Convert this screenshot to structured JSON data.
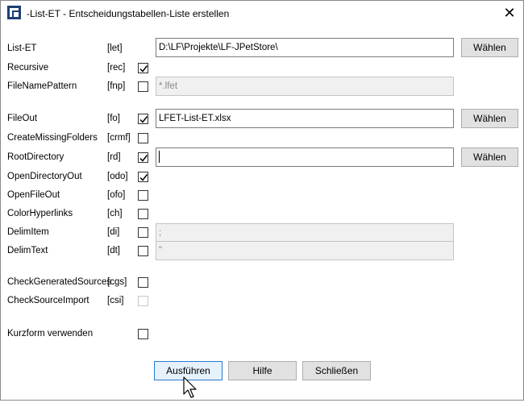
{
  "window": {
    "title": "-List-ET - Entscheidungstabellen-Liste erstellen",
    "close_glyph": "✕"
  },
  "rows": {
    "list_et": {
      "label": "List-ET",
      "abbr": "[let]",
      "value": "D:\\LF\\Projekte\\LF-JPetStore\\",
      "button": "Wählen"
    },
    "recursive": {
      "label": "Recursive",
      "abbr": "[rec]",
      "checked": true
    },
    "file_name_pattern": {
      "label": "FileNamePattern",
      "abbr": "[fnp]",
      "checked": false,
      "value": "*.lfet"
    },
    "file_out": {
      "label": "FileOut",
      "abbr": "[fo]",
      "checked": true,
      "value": "LFET-List-ET.xlsx",
      "button": "Wählen"
    },
    "create_missing_folders": {
      "label": "CreateMissingFolders",
      "abbr": "[crmf]",
      "checked": false
    },
    "root_directory": {
      "label": "RootDirectory",
      "abbr": "[rd]",
      "checked": true,
      "value": "",
      "button": "Wählen"
    },
    "open_directory_out": {
      "label": "OpenDirectoryOut",
      "abbr": "[odo]",
      "checked": true
    },
    "open_file_out": {
      "label": "OpenFileOut",
      "abbr": "[ofo]",
      "checked": false
    },
    "color_hyperlinks": {
      "label": "ColorHyperlinks",
      "abbr": "[ch]",
      "checked": false
    },
    "delim_item": {
      "label": "DelimItem",
      "abbr": "[di]",
      "checked": false,
      "value": ";"
    },
    "delim_text": {
      "label": "DelimText",
      "abbr": "[dt]",
      "checked": false,
      "value": "\""
    },
    "check_generated_sources": {
      "label": "CheckGeneratedSources",
      "abbr": "[cgs]",
      "checked": false
    },
    "check_source_import": {
      "label": "CheckSourceImport",
      "abbr": "[csi]",
      "checked": false,
      "disabled": true
    },
    "kurzform": {
      "label": "Kurzform verwenden",
      "checked": false
    }
  },
  "footer": {
    "run_label": "Ausführen",
    "help_label": "Hilfe",
    "close_label": "Schließen"
  },
  "colors": {
    "icon_blue": "#1f3f73",
    "primary_border": "#2a7ad0",
    "button_bg": "#e1e1e1",
    "disabled_field_bg": "#f0f0f0"
  },
  "icons": {
    "app": "lfet-app-icon",
    "close": "close-icon",
    "check": "checkmark-icon",
    "pointer": "mouse-pointer-icon"
  }
}
